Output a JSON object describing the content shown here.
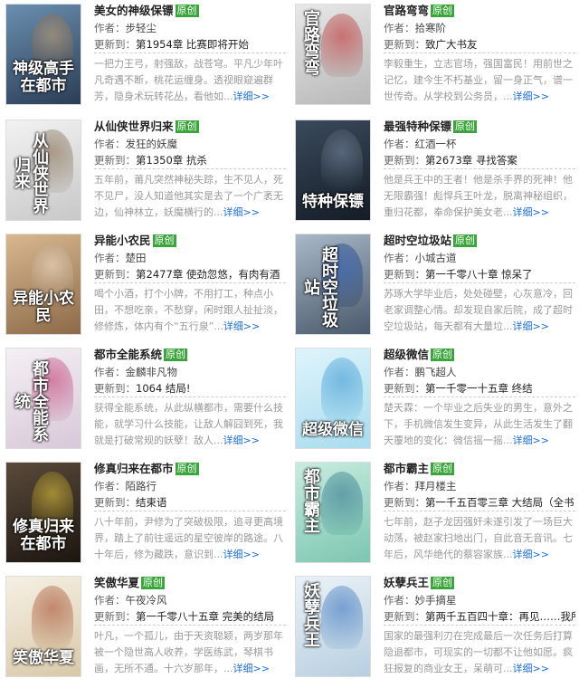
{
  "labels": {
    "author": "作者：",
    "updated": "更新到：",
    "badge": "原创",
    "more": "详细>>"
  },
  "books": [
    {
      "title": "美女的神级保镖",
      "author": "步轻尘",
      "chapter": "第1954章  比赛即将开始",
      "desc": "一把力王弓，射强敌，战苍穹。平凡少年叶凡奇遇不断，桃花运缠身。透视眼窥遍群芳，隐身术玩转花丛，看他如...",
      "cover": {
        "text": "神级高手在都市",
        "colors": [
          "#6a8fb0",
          "#2b3d55"
        ],
        "accent": "#c9a070",
        "vertical": false
      }
    },
    {
      "title": "官路弯弯",
      "author": "拾寒阶",
      "chapter": "致广大书友",
      "desc": "李毅重生，立志官场，强国富民！用前世之记忆，建今生不朽基业，留一身正气，谱一世传奇。从学校到公务员，...",
      "cover": {
        "text": "官路弯弯",
        "colors": [
          "#e8e8e8",
          "#b8b8b8"
        ],
        "accent": "#c02020",
        "vertical": true
      }
    },
    {
      "title": "从仙侠世界归来",
      "author": "发狂的妖魔",
      "chapter": "第1350章  抗杀",
      "desc": "五年前，莆凡突然神秘失踪，生不见人，死不见尸，没人知道他其实是去了一个广袤无边，仙神林立，妖魔横行的...",
      "cover": {
        "text": "从仙侠世界归来",
        "colors": [
          "#f2f2f2",
          "#c8c8c8"
        ],
        "accent": "#7a6040",
        "vertical": true
      }
    },
    {
      "title": "最强特种保镖",
      "author": "红酒一杯",
      "chapter": "第2673章  寻找答案",
      "desc": "他是兵王中的王者！他是杀手界的死神！他无限霸强！彪悍兵王叶龙，脱离神秘组织，重归花都，奉命保护美女老...",
      "cover": {
        "text": "特种保镖",
        "colors": [
          "#3a4a5c",
          "#141c26"
        ],
        "accent": "#7b8ea4",
        "vertical": false
      }
    },
    {
      "title": "异能小农民",
      "author": "楚田",
      "chapter": "第2477章  使劲忽悠，有肉有酒",
      "desc": "喝个小酒，打个小牌，不用打工，种点小田，不想吃亲，不愁穿，闲时跟人扯扯淡，修修炼，体内有个“五行泉”...",
      "cover": {
        "text": "异能小农民",
        "colors": [
          "#d8b890",
          "#8c6a48"
        ],
        "accent": "#f0e0c8",
        "vertical": false
      }
    },
    {
      "title": "超时空垃圾站",
      "author": "小城古道",
      "chapter": "第一千零八十章  惊呆了",
      "desc": "苏琢大学毕业后，处处碰壁，心灰意冷，回老家调整心情。却发现自家后院，成了超时空垃圾站，每天都有大量垃...",
      "cover": {
        "text": "超时空垃圾站",
        "colors": [
          "#a8b8c8",
          "#4a5a6c"
        ],
        "accent": "#1e4fb0",
        "vertical": true
      }
    },
    {
      "title": "都市全能系统",
      "author": "金麟非凡物",
      "chapter": "1064 结局!",
      "desc": "获得全能系统，从此纵横都市，需要什么技能，就学习什么技能，让敌人解囧到死，我就是打破常规的妖孽！敌人...",
      "cover": {
        "text": "都市全能系统",
        "colors": [
          "#f4f0f4",
          "#d8c8d8"
        ],
        "accent": "#c0306a",
        "vertical": true
      }
    },
    {
      "title": "超级微信",
      "author": "鹏飞超人",
      "chapter": "第一千零一十五章  终结",
      "desc": "楚天霖：一个毕业之后失业的男生，意外之下，手机微信发生变异，从此生活发生了翻天覆地的变化：微信摇一摇...",
      "cover": {
        "text": "超级微信",
        "colors": [
          "#dff4fb",
          "#a8dcee"
        ],
        "accent": "#2f8fd0",
        "vertical": false
      }
    },
    {
      "title": "修真归来在都市",
      "author": "陌路行",
      "chapter": "结束语",
      "desc": "八十年前，尹修为了突破极限，追寻更高境界，踏上了前往遥远的星空彼岸的路途。八十年后，修为藏跌，意识到...",
      "cover": {
        "text": "修真归来在都市",
        "colors": [
          "#5a4a3a",
          "#1c1610"
        ],
        "accent": "#f0d040",
        "vertical": false
      }
    },
    {
      "title": "都市霸主",
      "author": "拜月楼主",
      "chapter": "第一千五百零三章  大结局（全书",
      "desc": "七年前，赵子龙因强奸未遂引发了一场巨大动荡，被赵家扫地出门，自此音无音讯。七年后，风华绝代的蔡容家族...",
      "cover": {
        "text": "都市霸主",
        "colors": [
          "#c8ece0",
          "#7cc6b0"
        ],
        "accent": "#2a6a8a",
        "vertical": true
      }
    },
    {
      "title": "笑傲华夏",
      "author": "午夜冷风",
      "chapter": "第一千零八十五章  完美的结局",
      "desc": "叶凡，一个孤儿，由于天资聪颖，两岁那年被一个隐世高人收养，学医练武，琴棋书画，无所不通。十六岁那年，...",
      "cover": {
        "text": "笑傲华夏",
        "colors": [
          "#f6f0e4",
          "#d8c8a8"
        ],
        "accent": "#a04020",
        "vertical": false
      }
    },
    {
      "title": "妖孽兵王",
      "author": "妙手摘星",
      "chapter": "第两千五百四十章：再见……我所",
      "desc": "国家的最强利刃在完成最后一次任务后打算隐退都市，可现实的一切都不让他如愿。疯狂报复的商业女王，呆萌可...",
      "cover": {
        "text": "妖孽兵王",
        "colors": [
          "#eaf2f8",
          "#b8cfe0"
        ],
        "accent": "#2a68b8",
        "vertical": true
      }
    }
  ]
}
